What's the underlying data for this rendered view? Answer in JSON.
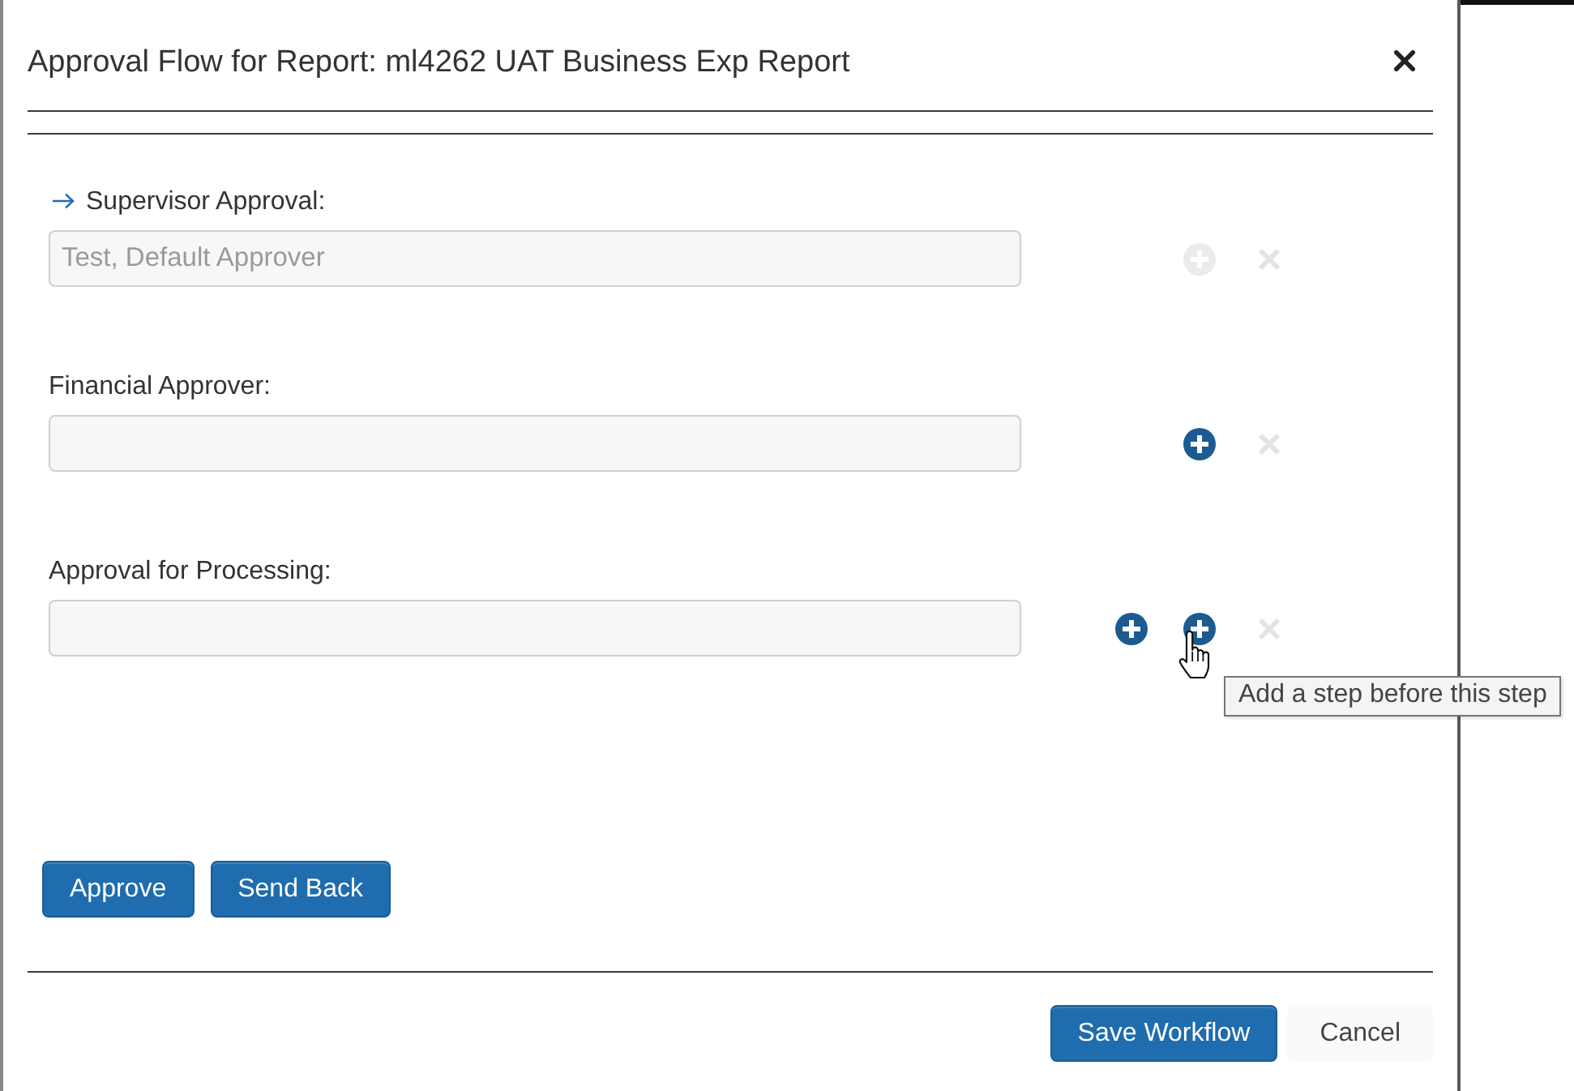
{
  "dialog": {
    "title": "Approval Flow for Report: ml4262 UAT Business Exp Report"
  },
  "steps": [
    {
      "label": "Supervisor Approval:",
      "current": true,
      "value": "Test, Default Approver",
      "add_after": false,
      "add_before": {
        "disabled": true,
        "hovered": false
      },
      "remove": {
        "disabled": true
      }
    },
    {
      "label": "Financial Approver:",
      "current": false,
      "add_after": false,
      "add_before": {
        "disabled": false,
        "hovered": false
      },
      "remove": {
        "disabled": true
      }
    },
    {
      "label": "Approval for Processing:",
      "current": false,
      "add_after": true,
      "add_before": {
        "disabled": false,
        "hovered": true,
        "tooltip": "Add a step before this step"
      },
      "remove": {
        "disabled": true
      }
    }
  ],
  "actions": [
    {
      "label": "Approve",
      "kind": "primary"
    },
    {
      "label": "Send Back",
      "kind": "primary"
    }
  ],
  "footer": {
    "buttons": [
      {
        "label": "Save Workflow",
        "kind": "primary"
      },
      {
        "label": "Cancel",
        "kind": "secondary"
      }
    ]
  }
}
